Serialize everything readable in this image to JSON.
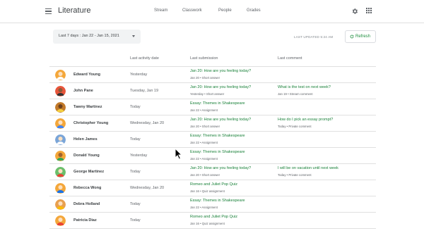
{
  "app": {
    "title": "Literature"
  },
  "nav": {
    "tabs": [
      "Stream",
      "Classwork",
      "People",
      "Grades"
    ]
  },
  "toolbar": {
    "date_filter": "Last 7 days : Jan 22 - Jan 15, 2021",
    "updated": "LAST UPDATED 5:24 AM",
    "refresh_label": "Refresh"
  },
  "table": {
    "headers": [
      "Last activity date",
      "Last submission",
      "Last comment"
    ],
    "rows": [
      {
        "name": "Edward Young",
        "activity": "Yesterday",
        "sub_title": "Jan 20: How are you feeling today?",
        "sub_meta": "Jan 20  •  Short answer",
        "com_title": "",
        "com_meta": "",
        "avatar": "#f4a73a"
      },
      {
        "name": "John Pane",
        "activity": "Tuesday, Jan 19",
        "sub_title": "Jan 20: How are you feeling today?",
        "sub_meta": "Yesterday  •  Short answer",
        "com_title": "What is the test on next week?",
        "com_meta": "Jan 19  •  Stream comment",
        "avatar": "#e8553a"
      },
      {
        "name": "Tawny Martinez",
        "activity": "Today",
        "sub_title": "Essay: Themes in Shakespeare",
        "sub_meta": "Jan 22  •  Assignment",
        "com_title": "",
        "com_meta": "",
        "avatar": "#c27a2a"
      },
      {
        "name": "Christopher Young",
        "activity": "Wednesday, Jan 20",
        "sub_title": "Jan 20: How are you feeling today?",
        "sub_meta": "Jan 20  •  Short answer",
        "com_title": "How do I pick an essay prompt?",
        "com_meta": "Today  •  Private comment",
        "avatar": "#f4a73a"
      },
      {
        "name": "Helen James",
        "activity": "Today",
        "sub_title": "Essay: Themes in Shakespeare",
        "sub_meta": "Jan 22  •  Assignment",
        "com_title": "",
        "com_meta": "",
        "avatar": "#7aa5d8"
      },
      {
        "name": "Donald Young",
        "activity": "Yesterday",
        "sub_title": "Essay: Themes in Shakespeare",
        "sub_meta": "Jan 22  •  Assignment",
        "com_title": "",
        "com_meta": "",
        "avatar": "#f4a73a"
      },
      {
        "name": "George Martinez",
        "activity": "Today",
        "sub_title": "Jan 20: How are you feeling today?",
        "sub_meta": "Jan 20  •  Short answer",
        "com_title": "I will be on vacation until next week",
        "com_meta": "Today  •  Private comment",
        "avatar": "#6bbf6b"
      },
      {
        "name": "Rebecca Wong",
        "activity": "Wednesday, Jan 20",
        "sub_title": "Romeo and Juliet Pop Quiz",
        "sub_meta": "Jan 16  •  Quiz assignment",
        "com_title": "",
        "com_meta": "",
        "avatar": "#f4a73a"
      },
      {
        "name": "Debra Holland",
        "activity": "Today",
        "sub_title": "Essay: Themes in Shakespeare",
        "sub_meta": "Jan 22  •  Assignment",
        "com_title": "",
        "com_meta": "",
        "avatar": "#e8a050"
      },
      {
        "name": "Patricia Diaz",
        "activity": "Today",
        "sub_title": "Romeo and Juliet Pop Quiz",
        "sub_meta": "Jan 16  •  Quiz assignment",
        "com_title": "",
        "com_meta": "",
        "avatar": "#f4a73a"
      }
    ]
  }
}
